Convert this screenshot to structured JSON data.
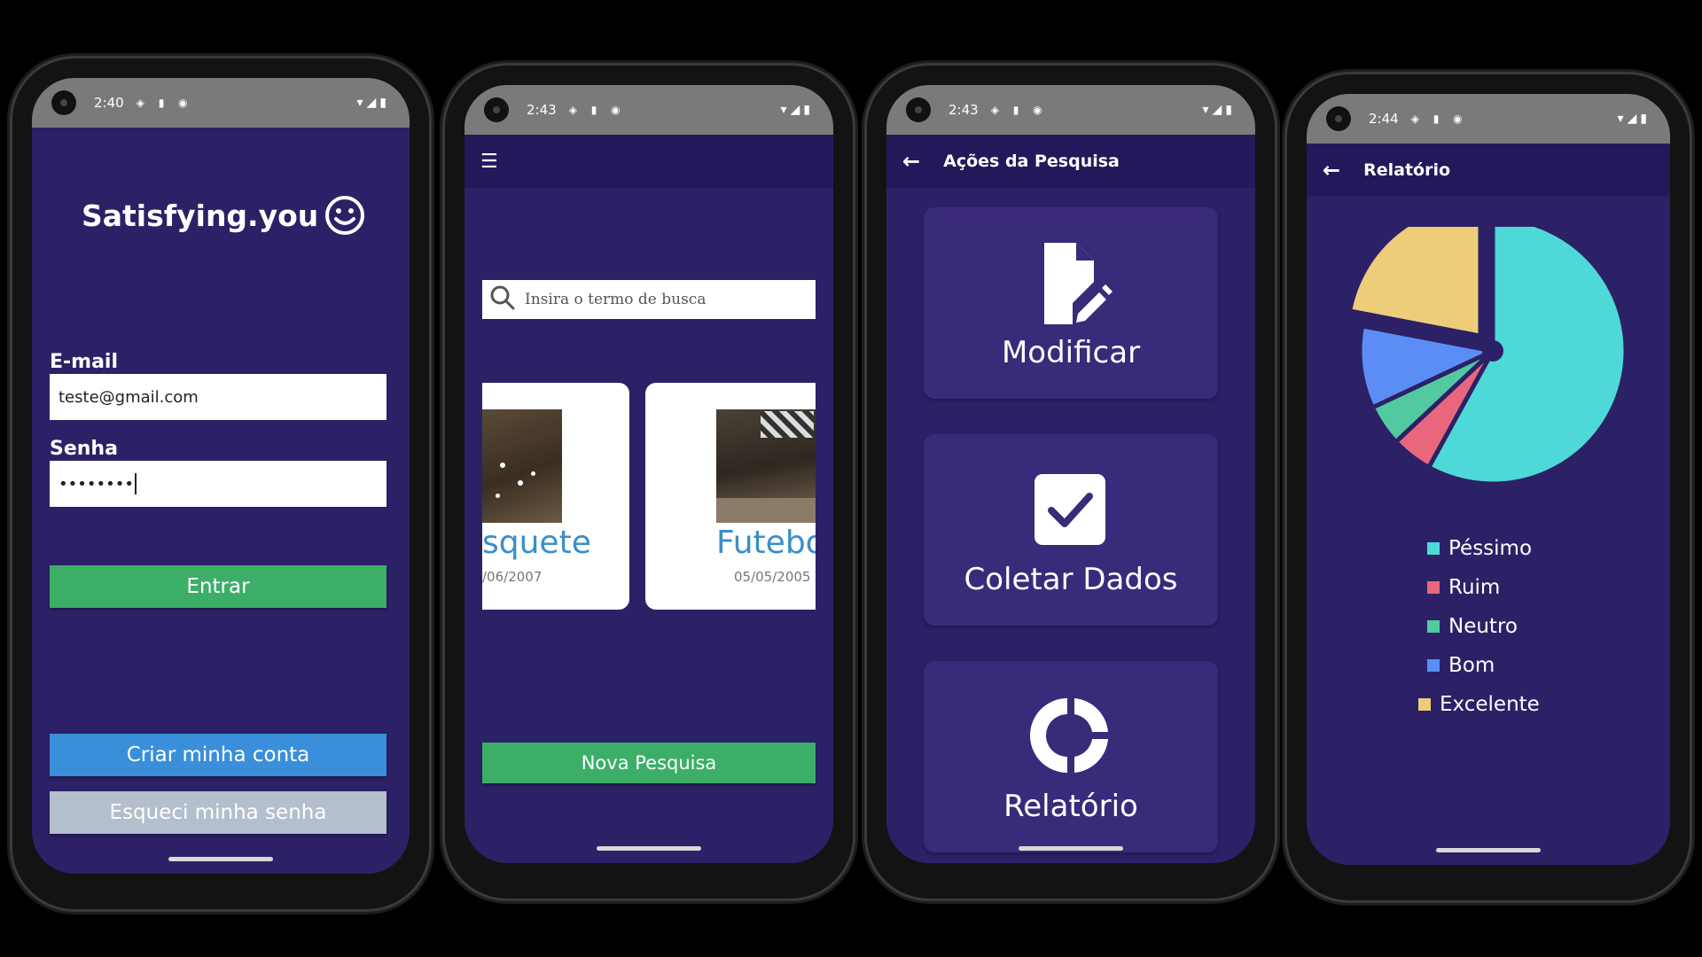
{
  "colors": {
    "background": "#2c2167",
    "appbar": "#23195a",
    "green": "#3dae68",
    "blue": "#3a8fdb",
    "gray": "#b3bfcc",
    "tile": "#3a2a7a",
    "link_blue": "#3a8ec9"
  },
  "phones": [
    {
      "status": {
        "time": "2:40"
      },
      "title": "Satisfying.you",
      "smiley_icon": "smiley-face-icon",
      "email_label": "E-mail",
      "email_value": "teste@gmail.com",
      "password_label": "Senha",
      "password_value": "••••••••",
      "enter_button": "Entrar",
      "create_account_button": "Criar minha conta",
      "forgot_password_button": "Esqueci minha senha"
    },
    {
      "status": {
        "time": "2:43"
      },
      "menu_icon": "hamburger-menu-icon",
      "search_placeholder": "Insira o termo de busca",
      "cards": [
        {
          "title": "squete",
          "date": "/06/2007"
        },
        {
          "title": "Futebo",
          "date": "05/05/2005"
        }
      ],
      "new_survey_button": "Nova Pesquisa"
    },
    {
      "status": {
        "time": "2:43"
      },
      "appbar_title": "Ações da Pesquisa",
      "tiles": [
        {
          "label": "Modificar",
          "icon": "edit-document-icon"
        },
        {
          "label": "Coletar Dados",
          "icon": "checkbox-icon"
        },
        {
          "label": "Relatório",
          "icon": "donut-chart-icon"
        }
      ]
    },
    {
      "status": {
        "time": "2:44"
      },
      "appbar_title": "Relatório",
      "legend": [
        {
          "name": "Péssimo",
          "color": "#4fd8d8"
        },
        {
          "name": "Ruim",
          "color": "#e8677c"
        },
        {
          "name": "Neutro",
          "color": "#52c9a0"
        },
        {
          "name": "Bom",
          "color": "#5b8ef5"
        },
        {
          "name": "Excelente",
          "color": "#eecd7a"
        }
      ]
    }
  ],
  "chart_data": {
    "type": "pie",
    "categories": [
      "Péssimo",
      "Ruim",
      "Neutro",
      "Bom",
      "Excelente"
    ],
    "values": [
      58,
      5,
      5,
      10,
      22
    ],
    "colors": [
      "#4fd8d8",
      "#e8677c",
      "#52c9a0",
      "#5b8ef5",
      "#eecd7a"
    ],
    "legend": "bottom"
  }
}
